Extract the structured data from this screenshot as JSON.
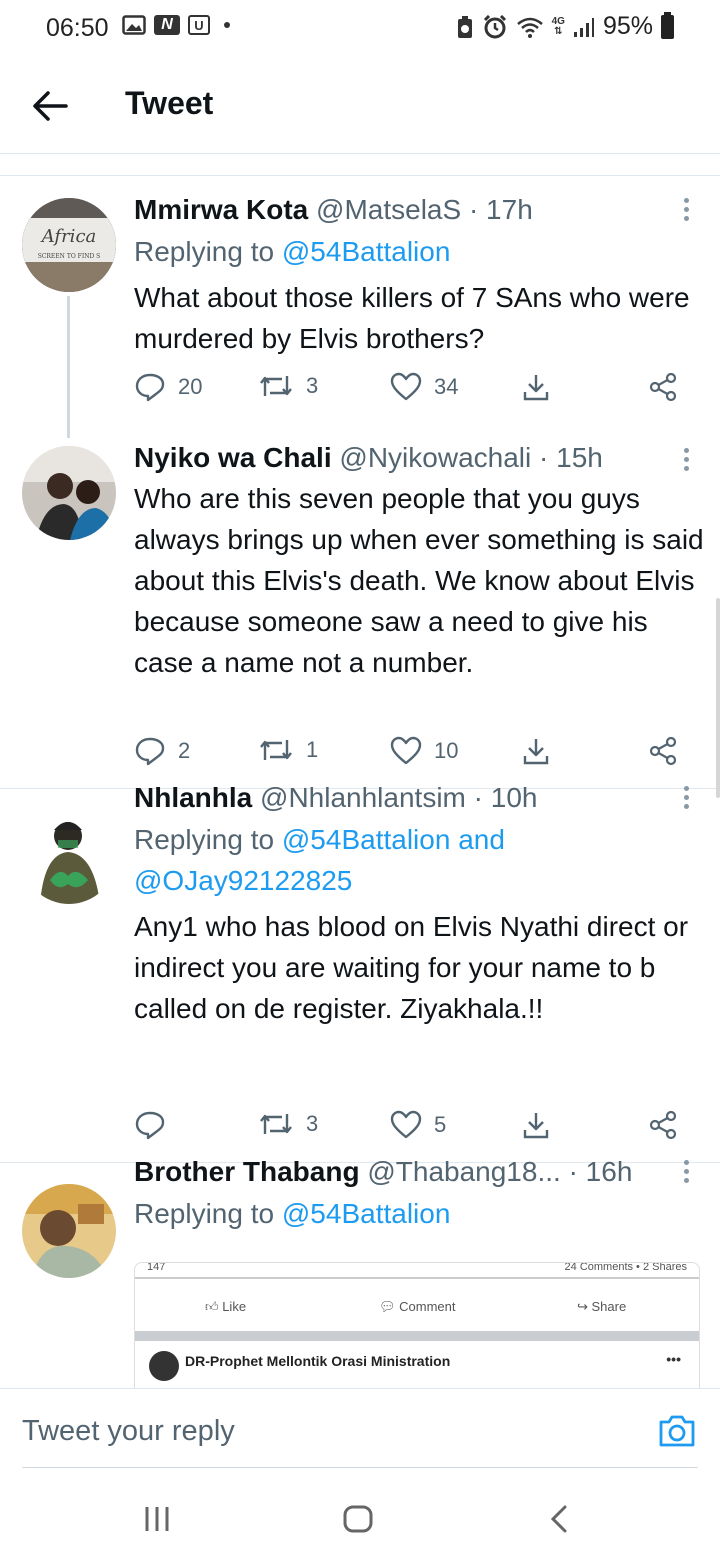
{
  "status_bar": {
    "time": "06:50",
    "notif_icons": [
      "gallery-icon",
      "n-icon",
      "u-icon"
    ],
    "network": "4G",
    "battery": "95%"
  },
  "header": {
    "title": "Tweet"
  },
  "tweets": [
    {
      "name": "Mmirwa Kota",
      "handle": "@MatselaS",
      "time": "· 17h",
      "reply_prefix": "Replying to ",
      "reply_to": "@54Battalion",
      "text": "What about those  killers of 7 SAns who were murdered by Elvis brothers?",
      "replies": "20",
      "retweets": "3",
      "likes": "34",
      "avatar_text": "Africa",
      "avatar_subtext": "SCREEN TO FIND S"
    },
    {
      "name": "Nyiko wa Chali",
      "handle": "@Nyikowachali",
      "time": "· 15h",
      "text": "Who are this seven people that you guys always brings up when ever something is said about this Elvis's death. We know about Elvis because someone saw a need to give his case a name not a number.",
      "replies": "2",
      "retweets": "1",
      "likes": "10"
    },
    {
      "name": "Nhlanhla",
      "handle": "@Nhlanhlantsim",
      "time": "· 10h",
      "reply_prefix": "Replying to ",
      "reply_to": "@54Battalion and",
      "reply_to_2": "@OJay92122825",
      "text": "Any1 who has blood on Elvis Nyathi direct or indirect you are waiting for your name to b called on de register. Ziyakhala.!!",
      "replies": "",
      "retweets": "3",
      "likes": "5"
    },
    {
      "name": "Brother Thabang",
      "handle": "@Thabang18...",
      "time": "· 16h",
      "reply_prefix": "Replying to ",
      "reply_to": "@54Battalion",
      "embed": {
        "reactions": "147",
        "stats": "24 Comments • 2 Shares",
        "like": "Like",
        "comment": "Comment",
        "share": "Share",
        "page_name": "DR-Prophet Mellontik Orasi Ministration",
        "dots": "•••"
      }
    }
  ],
  "reply_bar": {
    "placeholder": "Tweet your reply"
  },
  "colors": {
    "accent": "#1d9bf0",
    "text": "#0f1419",
    "muted": "#536471"
  }
}
